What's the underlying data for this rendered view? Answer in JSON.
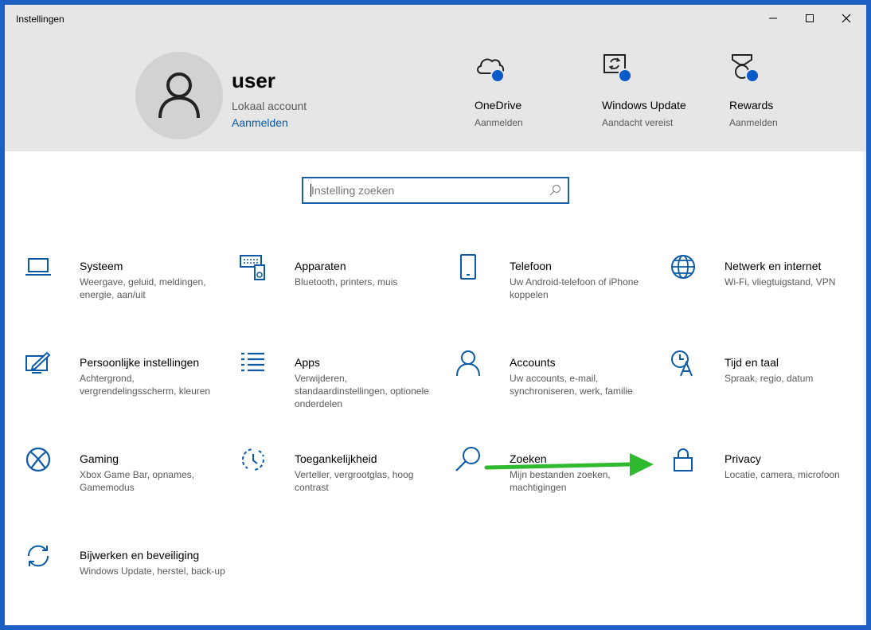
{
  "window": {
    "title": "Instellingen"
  },
  "account": {
    "name": "user",
    "type": "Lokaal account",
    "link": "Aanmelden"
  },
  "header_items": [
    {
      "title": "OneDrive",
      "subtitle": "Aanmelden"
    },
    {
      "title": "Windows Update",
      "subtitle": "Aandacht vereist"
    },
    {
      "title": "Rewards",
      "subtitle": "Aanmelden"
    }
  ],
  "search": {
    "placeholder": "Instelling zoeken"
  },
  "categories": [
    {
      "title": "Systeem",
      "desc": "Weergave, geluid, meldingen, energie, aan/uit"
    },
    {
      "title": "Apparaten",
      "desc": "Bluetooth, printers, muis"
    },
    {
      "title": "Telefoon",
      "desc": "Uw Android-telefoon of iPhone koppelen"
    },
    {
      "title": "Netwerk en internet",
      "desc": "Wi-Fi, vliegtuigstand, VPN"
    },
    {
      "title": "Persoonlijke instellingen",
      "desc": "Achtergrond, vergrendelingsscherm, kleuren"
    },
    {
      "title": "Apps",
      "desc": "Verwijderen, standaardinstellingen, optionele onderdelen"
    },
    {
      "title": "Accounts",
      "desc": "Uw accounts, e-mail, synchroniseren, werk, familie"
    },
    {
      "title": "Tijd en taal",
      "desc": "Spraak, regio, datum"
    },
    {
      "title": "Gaming",
      "desc": "Xbox Game Bar, opnames, Gamemodus"
    },
    {
      "title": "Toegankelijkheid",
      "desc": "Verteller, vergrootglas, hoog contrast"
    },
    {
      "title": "Zoeken",
      "desc": "Mijn bestanden zoeken, machtigingen"
    },
    {
      "title": "Privacy",
      "desc": "Locatie, camera, microfoon"
    },
    {
      "title": "Bijwerken en beveiliging",
      "desc": "Windows Update, herstel, back-up"
    }
  ],
  "icons": [
    "laptop-icon",
    "devices-icon",
    "phone-icon",
    "globe-icon",
    "personalize-icon",
    "apps-icon",
    "person-icon",
    "time-language-icon",
    "xbox-icon",
    "accessibility-icon",
    "search-icon",
    "lock-icon",
    "update-icon"
  ],
  "colors": {
    "accent": "#0a5ac8",
    "icon": "#0a5aa8",
    "arrow": "#2fba2f",
    "header_bg": "#e6e6e6"
  }
}
